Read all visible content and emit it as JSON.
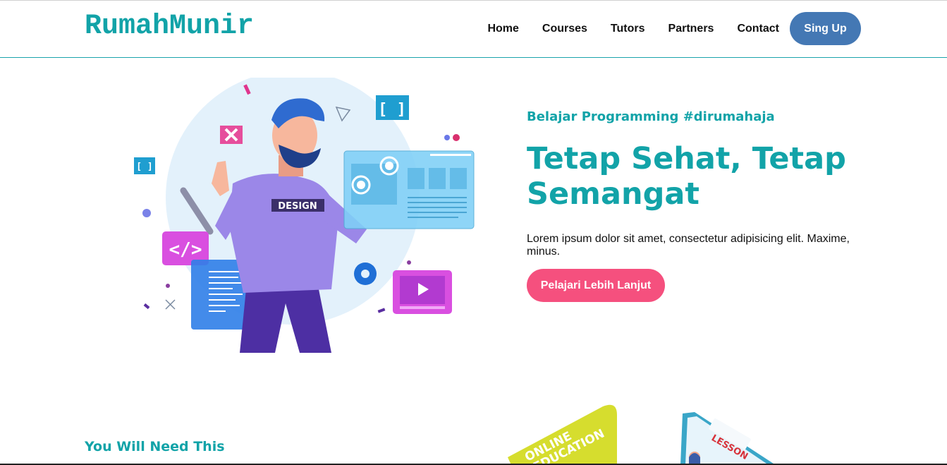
{
  "header": {
    "logo": "RumahMunir",
    "nav": [
      "Home",
      "Courses",
      "Tutors",
      "Partners",
      "Contact"
    ],
    "signup_label": "Sing Up"
  },
  "hero": {
    "subtitle": "Belajar Programming #dirumahaja",
    "title": "Tetap Sehat, Tetap Semangat",
    "description": "Lorem ipsum dolor sit amet, consectetur adipisicing elit. Maxime, minus.",
    "cta_label": "Pelajari Lebih Lanjut",
    "illustration_text": "DESIGN"
  },
  "section": {
    "heading": "You Will Need This",
    "card_text_1": "ONLINE",
    "card_text_2": "EDUCATION",
    "card_text_3": "LESSON"
  },
  "colors": {
    "brand": "#12a3a8",
    "primary_button": "#4478b4",
    "cta_button": "#f5507e"
  }
}
